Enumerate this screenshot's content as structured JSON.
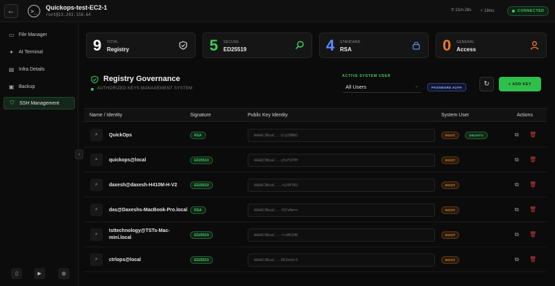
{
  "topbar": {
    "title": "Quickops-test-EC2-1",
    "subtitle": "root@13.203.158.64",
    "session_time": "⏱ 21m 28s",
    "latency": "⚡ 18ms",
    "status": "CONNECTED",
    "logo_glyph": ">_"
  },
  "sidebar": {
    "items": [
      {
        "label": "File Manager",
        "icon": "folder-icon"
      },
      {
        "label": "AI Terminal",
        "icon": "sparkle-icon"
      },
      {
        "label": "Infra Details",
        "icon": "server-icon"
      },
      {
        "label": "Backup",
        "icon": "archive-icon"
      },
      {
        "label": "SSH Management",
        "icon": "shield-icon",
        "active": true
      }
    ]
  },
  "cards": [
    {
      "num": "9",
      "label": "TOTAL",
      "value": "Registry",
      "color": "#ffffff",
      "icon": "shield-icon"
    },
    {
      "num": "5",
      "label": "SECURE",
      "value": "ED25519",
      "color": "#3ecf5a",
      "icon": "search-icon"
    },
    {
      "num": "4",
      "label": "STANDARD",
      "value": "RSA",
      "color": "#5a8dff",
      "icon": "lock-icon"
    },
    {
      "num": "0",
      "label": "GENERAL",
      "value": "Access",
      "color": "#f07a2a",
      "icon": "user-icon"
    }
  ],
  "governance": {
    "title": "Registry Governance",
    "subtitle": "AUTHORIZED KEYS MANAGEMENT SYSTEM",
    "active_user_label": "ACTIVE SYSTEM USER",
    "selected_user": "All Users",
    "auth_badge": "PASSWORD AUTH",
    "add_key": "+ ADD KEY"
  },
  "table": {
    "headers": [
      "Name / Identity",
      "Signature",
      "Public Key Identity",
      "System User",
      "Actions"
    ],
    "rows": [
      {
        "name": "QuickOps",
        "sig": "RSA",
        "key": "AAAAC3NzaC...U/gY8NN2",
        "users": [
          "ROOT",
          "UBUNTU"
        ]
      },
      {
        "name": "quickops@local",
        "sig": "ED25519",
        "key": "AAAAC3NzaC...y5sF1PPH",
        "users": [
          "ROOT"
        ]
      },
      {
        "name": "daxesh@daxesh-H410M-H-V2",
        "sig": "ED25519",
        "key": "AAAAC3NzaC.../e29F382",
        "users": [
          "ROOT"
        ]
      },
      {
        "name": "das@Daxeshs-MacBook-Pro.local",
        "sig": "RSA",
        "key": "AAAAC3NzaC...fQ7vHm==",
        "users": [
          "ROOT"
        ]
      },
      {
        "name": "tsttechnology@TSTs-Mac-mini.local",
        "sig": "ED25519",
        "key": "AAAAC3NzaC...rtsBO1HR",
        "users": [
          "ROOT"
        ]
      },
      {
        "name": "ctrlops@local",
        "sig": "ED25519",
        "key": "AAAAC3NzaC...EKZeb9r5",
        "users": [
          "ROOT"
        ]
      }
    ]
  }
}
